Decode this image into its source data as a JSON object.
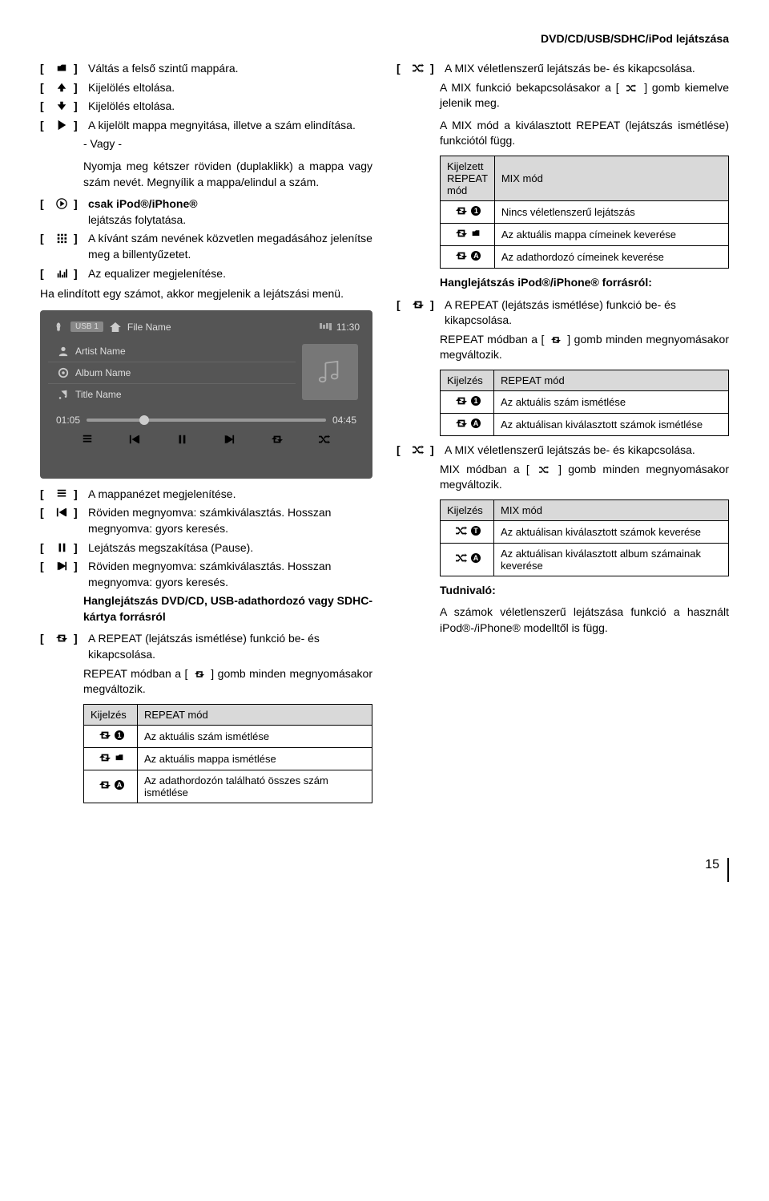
{
  "header": "DVD/CD/USB/SDHC/iPod lejátszása",
  "left": {
    "items1": [
      "Váltás a felső szintű mappára.",
      "Kijelölés eltolása.",
      "Kijelölés eltolása.",
      "A kijelölt mappa megnyitása, illetve a szám elindítása."
    ],
    "vagy": "- Vagy -",
    "vagy_text": "Nyomja meg kétszer röviden (duplaklikk) a mappa vagy szám nevét. Megnyílik a mappa/elindul a szám.",
    "items2": [
      "csak iPod®/iPhone® lejátszás folytatása.",
      "A kívánt szám nevének közvetlen megadásához jelenítse meg a billentyűzetet.",
      "Az equalizer megjelenítése."
    ],
    "ha_text": "Ha elindított egy számot, akkor megjelenik a lejátszási menü.",
    "screenshot": {
      "usb": "USB 1",
      "file": "File Name",
      "time": "11:30",
      "artist": "Artist Name",
      "album": "Album Name",
      "title": "Title Name",
      "t1": "01:05",
      "t2": "04:45"
    },
    "items3": [
      "A mappanézet megjelenítése.",
      "Röviden megnyomva: számkiválasztás. Hosszan megnyomva: gyors keresés.",
      "Lejátszás megszakítása (Pause).",
      "Röviden megnyomva: számkiválasztás. Hosszan megnyomva: gyors keresés."
    ],
    "hang_heading": "Hanglejátszás DVD/CD, USB-adathordozó vagy SDHC-kártya forrásról",
    "repeat_item": "A REPEAT (lejátszás ismétlése) funkció be- és kikapcsolása.",
    "repeat_text": "REPEAT módban a [    ] gomb minden megnyomásakor megváltozik.",
    "table1": {
      "h1": "Kijelzés",
      "h2": "REPEAT mód",
      "r1": "Az aktuális szám ismétlése",
      "r2": "Az aktuális mappa ismétlése",
      "r3": "Az adathordozón található összes szám ismétlése"
    }
  },
  "right": {
    "mix_item": "A MIX véletlenszerű lejátszás be- és kikapcsolása.",
    "mix_text1": "A MIX funkció bekapcsolásakor a [    ] gomb kiemelve jelenik meg.",
    "mix_text2": "A MIX mód a kiválasztott REPEAT (lejátszás ismétlése) funkciótól függ.",
    "table2": {
      "h1": "Kijelzett REPEAT mód",
      "h2": "MIX mód",
      "r1": "Nincs véletlenszerű lejátszás",
      "r2": "Az aktuális mappa címeinek keverése",
      "r3": "Az adathordozó címeinek keverése"
    },
    "hang_heading2": "Hanglejátszás iPod®/iPhone® forrásról:",
    "repeat_item2": "A REPEAT (lejátszás ismétlése) funkció be- és kikapcsolása.",
    "repeat_text2": "REPEAT módban a [    ] gomb minden megnyomásakor megváltozik.",
    "table3": {
      "h1": "Kijelzés",
      "h2": "REPEAT mód",
      "r1": "Az aktuális szám ismétlése",
      "r2": "Az aktuálisan kiválasztott számok ismétlése"
    },
    "mix_item2": "A MIX véletlenszerű lejátszás be- és kikapcsolása.",
    "mix_text3": "MIX módban a [    ] gomb minden megnyomásakor megváltozik.",
    "table4": {
      "h1": "Kijelzés",
      "h2": "MIX mód",
      "r1": "Az aktuálisan kiválasztott számok keverése",
      "r2": "Az aktuálisan kiválasztott album számainak keverése"
    },
    "tudnivalo": "Tudnivaló:",
    "tudnivalo_text": "A számok véletlenszerű lejátszása funkció a használt iPod®-/iPhone® modelltől is függ."
  },
  "page": "15"
}
